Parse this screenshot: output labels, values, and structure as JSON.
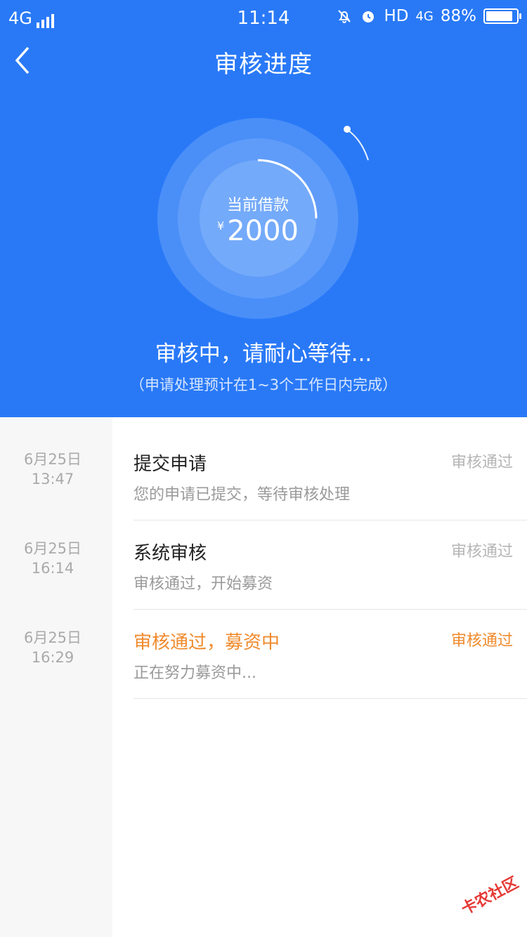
{
  "status_bar": {
    "network": "4G",
    "time": "11:14",
    "hd": "HD",
    "network2": "4G",
    "battery": "88%",
    "battery_level": 0.88
  },
  "navbar": {
    "title": "审核进度",
    "back_icon": "chevron-left-icon"
  },
  "loan": {
    "label": "当前借款",
    "currency": "¥",
    "amount": "2000"
  },
  "status": {
    "main": "审核中，请耐心等待...",
    "sub": "（申请处理预计在1~3个工作日内完成）"
  },
  "timeline": [
    {
      "date": "6月25日",
      "time": "13:47",
      "title": "提交申请",
      "desc": "您的申请已提交，等待审核处理",
      "status": "审核通过",
      "active": false
    },
    {
      "date": "6月25日",
      "time": "16:14",
      "title": "系统审核",
      "desc": "审核通过，开始募资",
      "status": "审核通过",
      "active": false
    },
    {
      "date": "6月25日",
      "time": "16:29",
      "title": "审核通过，募资中",
      "desc": "正在努力募资中...",
      "status": "审核通过",
      "active": true
    }
  ],
  "watermark": "卡农社区",
  "colors": {
    "primary": "#2979f7",
    "accent": "#f08a2c",
    "muted": "#9a9a9a"
  }
}
